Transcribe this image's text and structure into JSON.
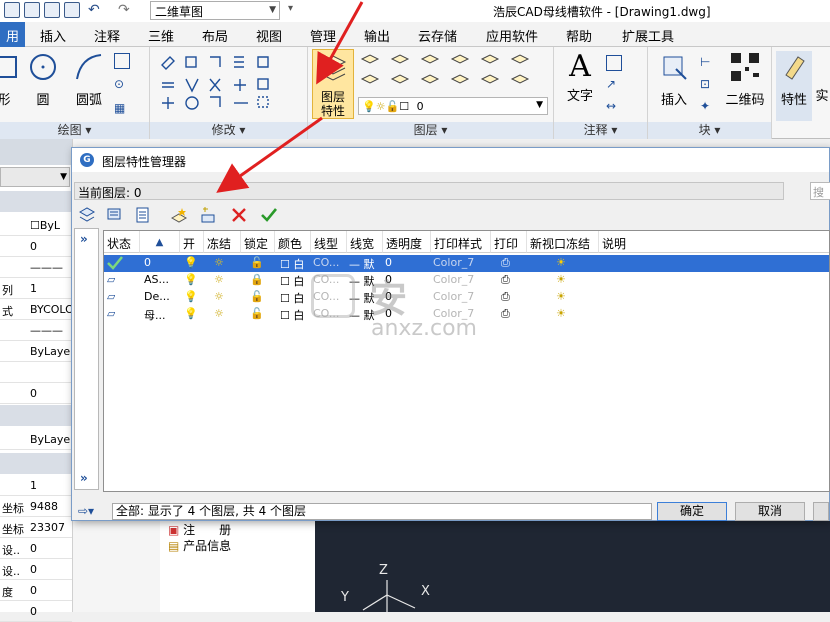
{
  "titlebar": {
    "workspace_combo": "二维草图",
    "app_title": "浩辰CAD母线槽软件 - [Drawing1.dwg]"
  },
  "menu_tabs": [
    {
      "label": "用",
      "active": true
    },
    {
      "label": "插入"
    },
    {
      "label": "注释"
    },
    {
      "label": "三维"
    },
    {
      "label": "布局"
    },
    {
      "label": "视图"
    },
    {
      "label": "管理"
    },
    {
      "label": "输出"
    },
    {
      "label": "云存储"
    },
    {
      "label": "应用软件"
    },
    {
      "label": "帮助"
    },
    {
      "label": "扩展工具"
    }
  ],
  "ribbon": {
    "draw_panel": {
      "title": "绘图",
      "buttons": [
        "形",
        "圆",
        "圆弧"
      ]
    },
    "modify_panel": {
      "title": "修改"
    },
    "layer_panel": {
      "title": "图层",
      "big_button_line1": "图层",
      "big_button_line2": "特性",
      "layer_combo_value": "0"
    },
    "annotate_panel": {
      "title": "注释",
      "button": "文字"
    },
    "block_panel": {
      "title": "块",
      "buttons": [
        "插入",
        "二维码"
      ]
    },
    "properties_button": "特性",
    "cut_button": "实"
  },
  "left_panel": {
    "rows": [
      {
        "label": "",
        "value": "☐ByL"
      },
      {
        "label": "",
        "value": "0"
      },
      {
        "label": "",
        "value": "———"
      },
      {
        "label": "列",
        "value": "1"
      },
      {
        "label": "式",
        "value": "BYCOLO"
      },
      {
        "label": "",
        "value": "———"
      },
      {
        "label": "",
        "value": "ByLaye"
      },
      {
        "label": "",
        "value": ""
      },
      {
        "label": "",
        "value": "0"
      },
      {
        "label": "",
        "value": "ByLaye"
      },
      {
        "label": "",
        "value": "1"
      },
      {
        "label": "坐标",
        "value": "9488"
      },
      {
        "label": "坐标",
        "value": "23307"
      },
      {
        "label": "设..",
        "value": "0"
      },
      {
        "label": "设..",
        "value": "0"
      },
      {
        "label": "度",
        "value": "0"
      },
      {
        "label": "",
        "value": "0"
      }
    ]
  },
  "sub_list": {
    "items": [
      "注　　册",
      "产品信息"
    ]
  },
  "dialog": {
    "title": "图层特性管理器",
    "current_layer_label": "当前图层: 0",
    "search_placeholder": "搜索",
    "nav_toggle": "»",
    "columns": [
      "状态",
      "▲",
      "开",
      "冻结",
      "锁定",
      "颜色",
      "线型",
      "线宽",
      "透明度",
      "打印样式",
      "打印",
      "新视口冻结",
      "说明"
    ],
    "rows": [
      {
        "name": "0",
        "color": "白",
        "linetype": "CO...",
        "lineweight": "— 默",
        "transparency": "0",
        "plotstyle": "Color_7",
        "selected": true,
        "current": true
      },
      {
        "name": "AS...",
        "color": "白",
        "linetype": "CO...",
        "lineweight": "— 默",
        "transparency": "0",
        "plotstyle": "Color_7",
        "selected": false,
        "current": false
      },
      {
        "name": "De...",
        "color": "白",
        "linetype": "CO...",
        "lineweight": "— 默",
        "transparency": "0",
        "plotstyle": "Color_7",
        "selected": false,
        "current": false
      },
      {
        "name": "母...",
        "color": "白",
        "linetype": "CO...",
        "lineweight": "— 默",
        "transparency": "0",
        "plotstyle": "Color_7",
        "selected": false,
        "current": false
      }
    ],
    "status_text": "全部: 显示了 4 个图层, 共 4 个图层",
    "ok_label": "确定",
    "cancel_label": "取消"
  },
  "drawing": {
    "axis_z": "Z",
    "axis_y": "Y",
    "axis_x": "X"
  },
  "watermark": {
    "text_top": "安",
    "text_bottom": "anxz.com"
  },
  "colors": {
    "accent": "#2f6ec2",
    "selection": "#2f6fd4",
    "annotation_arrow": "#e02020"
  }
}
